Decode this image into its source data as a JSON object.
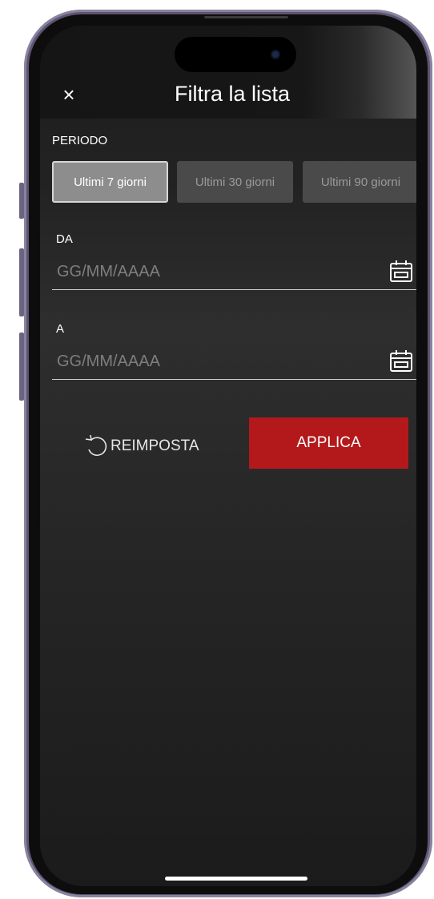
{
  "header": {
    "title": "Filtra la lista",
    "close_icon": "close-icon",
    "close_glyph": "×"
  },
  "period": {
    "label": "PERIODO",
    "options": [
      {
        "label": "Ultimi 7 giorni",
        "selected": true
      },
      {
        "label": "Ultimi 30 giorni",
        "selected": false
      },
      {
        "label": "Ultimi 90 giorni",
        "selected": false
      }
    ]
  },
  "from": {
    "label": "DA",
    "placeholder": "GG/MM/AAAA",
    "value": "",
    "icon": "calendar-icon"
  },
  "to": {
    "label": "A",
    "placeholder": "GG/MM/AAAA",
    "value": "",
    "icon": "calendar-icon"
  },
  "actions": {
    "reset_label": "REIMPOSTA",
    "reset_icon": "reset-icon",
    "apply_label": "APPLICA"
  },
  "colors": {
    "background": "#222222",
    "accent_red": "#b3191b",
    "selected_chip": "#8d8d8d",
    "chip": "#4a4a4a"
  }
}
